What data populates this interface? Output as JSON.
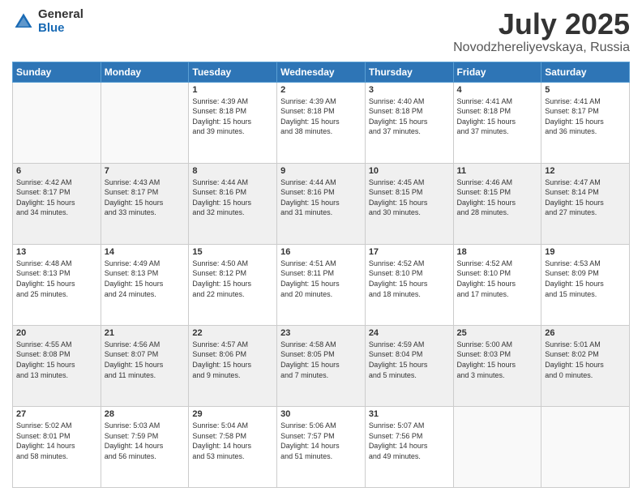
{
  "logo": {
    "general": "General",
    "blue": "Blue"
  },
  "header": {
    "title": "July 2025",
    "subtitle": "Novodzhereliyevskaya, Russia"
  },
  "days_of_week": [
    "Sunday",
    "Monday",
    "Tuesday",
    "Wednesday",
    "Thursday",
    "Friday",
    "Saturday"
  ],
  "weeks": [
    {
      "shaded": false,
      "days": [
        {
          "num": "",
          "info": ""
        },
        {
          "num": "",
          "info": ""
        },
        {
          "num": "1",
          "info": "Sunrise: 4:39 AM\nSunset: 8:18 PM\nDaylight: 15 hours\nand 39 minutes."
        },
        {
          "num": "2",
          "info": "Sunrise: 4:39 AM\nSunset: 8:18 PM\nDaylight: 15 hours\nand 38 minutes."
        },
        {
          "num": "3",
          "info": "Sunrise: 4:40 AM\nSunset: 8:18 PM\nDaylight: 15 hours\nand 37 minutes."
        },
        {
          "num": "4",
          "info": "Sunrise: 4:41 AM\nSunset: 8:18 PM\nDaylight: 15 hours\nand 37 minutes."
        },
        {
          "num": "5",
          "info": "Sunrise: 4:41 AM\nSunset: 8:17 PM\nDaylight: 15 hours\nand 36 minutes."
        }
      ]
    },
    {
      "shaded": true,
      "days": [
        {
          "num": "6",
          "info": "Sunrise: 4:42 AM\nSunset: 8:17 PM\nDaylight: 15 hours\nand 34 minutes."
        },
        {
          "num": "7",
          "info": "Sunrise: 4:43 AM\nSunset: 8:17 PM\nDaylight: 15 hours\nand 33 minutes."
        },
        {
          "num": "8",
          "info": "Sunrise: 4:44 AM\nSunset: 8:16 PM\nDaylight: 15 hours\nand 32 minutes."
        },
        {
          "num": "9",
          "info": "Sunrise: 4:44 AM\nSunset: 8:16 PM\nDaylight: 15 hours\nand 31 minutes."
        },
        {
          "num": "10",
          "info": "Sunrise: 4:45 AM\nSunset: 8:15 PM\nDaylight: 15 hours\nand 30 minutes."
        },
        {
          "num": "11",
          "info": "Sunrise: 4:46 AM\nSunset: 8:15 PM\nDaylight: 15 hours\nand 28 minutes."
        },
        {
          "num": "12",
          "info": "Sunrise: 4:47 AM\nSunset: 8:14 PM\nDaylight: 15 hours\nand 27 minutes."
        }
      ]
    },
    {
      "shaded": false,
      "days": [
        {
          "num": "13",
          "info": "Sunrise: 4:48 AM\nSunset: 8:13 PM\nDaylight: 15 hours\nand 25 minutes."
        },
        {
          "num": "14",
          "info": "Sunrise: 4:49 AM\nSunset: 8:13 PM\nDaylight: 15 hours\nand 24 minutes."
        },
        {
          "num": "15",
          "info": "Sunrise: 4:50 AM\nSunset: 8:12 PM\nDaylight: 15 hours\nand 22 minutes."
        },
        {
          "num": "16",
          "info": "Sunrise: 4:51 AM\nSunset: 8:11 PM\nDaylight: 15 hours\nand 20 minutes."
        },
        {
          "num": "17",
          "info": "Sunrise: 4:52 AM\nSunset: 8:10 PM\nDaylight: 15 hours\nand 18 minutes."
        },
        {
          "num": "18",
          "info": "Sunrise: 4:52 AM\nSunset: 8:10 PM\nDaylight: 15 hours\nand 17 minutes."
        },
        {
          "num": "19",
          "info": "Sunrise: 4:53 AM\nSunset: 8:09 PM\nDaylight: 15 hours\nand 15 minutes."
        }
      ]
    },
    {
      "shaded": true,
      "days": [
        {
          "num": "20",
          "info": "Sunrise: 4:55 AM\nSunset: 8:08 PM\nDaylight: 15 hours\nand 13 minutes."
        },
        {
          "num": "21",
          "info": "Sunrise: 4:56 AM\nSunset: 8:07 PM\nDaylight: 15 hours\nand 11 minutes."
        },
        {
          "num": "22",
          "info": "Sunrise: 4:57 AM\nSunset: 8:06 PM\nDaylight: 15 hours\nand 9 minutes."
        },
        {
          "num": "23",
          "info": "Sunrise: 4:58 AM\nSunset: 8:05 PM\nDaylight: 15 hours\nand 7 minutes."
        },
        {
          "num": "24",
          "info": "Sunrise: 4:59 AM\nSunset: 8:04 PM\nDaylight: 15 hours\nand 5 minutes."
        },
        {
          "num": "25",
          "info": "Sunrise: 5:00 AM\nSunset: 8:03 PM\nDaylight: 15 hours\nand 3 minutes."
        },
        {
          "num": "26",
          "info": "Sunrise: 5:01 AM\nSunset: 8:02 PM\nDaylight: 15 hours\nand 0 minutes."
        }
      ]
    },
    {
      "shaded": false,
      "days": [
        {
          "num": "27",
          "info": "Sunrise: 5:02 AM\nSunset: 8:01 PM\nDaylight: 14 hours\nand 58 minutes."
        },
        {
          "num": "28",
          "info": "Sunrise: 5:03 AM\nSunset: 7:59 PM\nDaylight: 14 hours\nand 56 minutes."
        },
        {
          "num": "29",
          "info": "Sunrise: 5:04 AM\nSunset: 7:58 PM\nDaylight: 14 hours\nand 53 minutes."
        },
        {
          "num": "30",
          "info": "Sunrise: 5:06 AM\nSunset: 7:57 PM\nDaylight: 14 hours\nand 51 minutes."
        },
        {
          "num": "31",
          "info": "Sunrise: 5:07 AM\nSunset: 7:56 PM\nDaylight: 14 hours\nand 49 minutes."
        },
        {
          "num": "",
          "info": ""
        },
        {
          "num": "",
          "info": ""
        }
      ]
    }
  ]
}
